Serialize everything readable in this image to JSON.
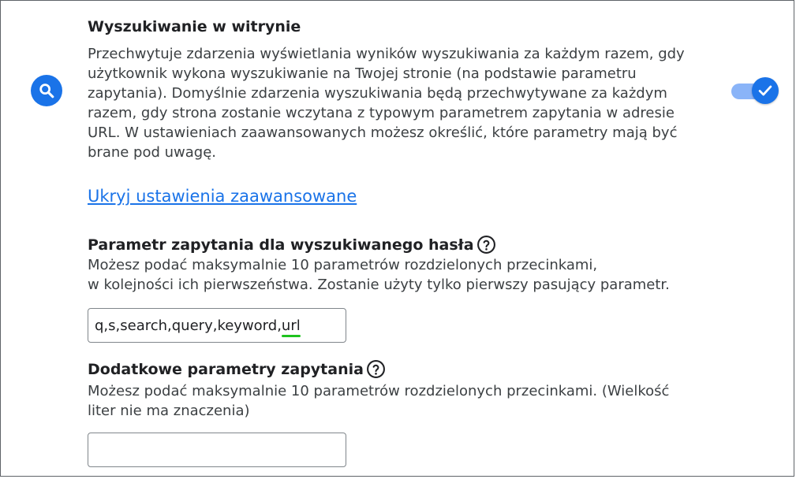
{
  "site_search": {
    "icon": "search-icon",
    "title": "Wyszukiwanie w witrynie",
    "description_lines": [
      "Przechwytuje zdarzenia wyświetlania wyników wyszukiwania za każdym razem, gdy",
      "użytkownik wykona wyszukiwanie na Twojej stronie (na podstawie parametru",
      "zapytania). Domyślnie zdarzenia wyszukiwania będą przechwytywane za każdym",
      "razem, gdy strona zostanie wczytana z typowym parametrem zapytania w adresie",
      "URL. W ustawieniach zaawansowanych możesz określić, które parametry mają być",
      "brane pod uwagę."
    ],
    "toggle_on": true,
    "toggle_icon": "check-icon"
  },
  "advanced_link": "Ukryj ustawienia zaawansowane",
  "query_param": {
    "label": "Parametr zapytania dla wyszukiwanego hasła",
    "help_icon": "help-circle-icon",
    "help_lines": [
      "Możesz podać maksymalnie 10 parametrów rozdzielonych przecinkami,",
      "w kolejności ich pierwszeństwa. Zostanie użyty tylko pierwszy pasujący parametr."
    ],
    "value_prefix": "q,s,search,query,keyword,",
    "value_highlighted": "url"
  },
  "additional_params": {
    "label": "Dodatkowe parametry zapytania",
    "help_icon": "help-circle-icon",
    "help_lines": [
      "Możesz podać maksymalnie 10 parametrów rozdzielonych przecinkami. (Wielkość",
      "liter nie ma znaczenia)"
    ],
    "value": ""
  },
  "colors": {
    "accent": "#1a73e8",
    "toggle_track": "#8ab4f8",
    "text_primary": "#202124",
    "text_secondary": "#3c4043",
    "spellcheck_underline": "#1ec31e"
  }
}
